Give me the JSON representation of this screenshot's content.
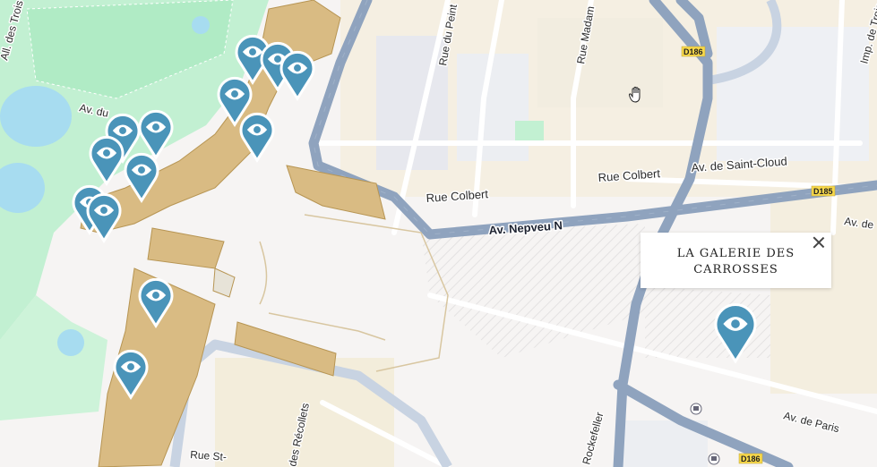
{
  "map": {
    "streets": [
      {
        "id": "rue-colbert-1",
        "text": "Rue Colbert"
      },
      {
        "id": "rue-colbert-2",
        "text": "Rue Colbert"
      },
      {
        "id": "av-saint-cloud",
        "text": "Av. de Saint-Cloud"
      },
      {
        "id": "av-nepveu",
        "text": "Av. Nepveu N"
      },
      {
        "id": "rue-peintres",
        "text": "Rue du Peint"
      },
      {
        "id": "rue-madame",
        "text": "Rue Madam"
      },
      {
        "id": "imp-trois",
        "text": "Imp. de Trois"
      },
      {
        "id": "av-du",
        "text": "Av. du"
      },
      {
        "id": "all-trois",
        "text": "All. des Trois"
      },
      {
        "id": "av-de-right",
        "text": "Av. de"
      },
      {
        "id": "av-paris",
        "text": "Av. de Paris"
      },
      {
        "id": "rue-st",
        "text": "Rue St-"
      },
      {
        "id": "rue-recollets",
        "text": "des Récollets"
      },
      {
        "id": "rockefeller",
        "text": "Rockefeller"
      }
    ],
    "shields": [
      {
        "id": "d186-top",
        "text": "D186"
      },
      {
        "id": "d185",
        "text": "D185"
      },
      {
        "id": "d186-bottom",
        "text": "D186"
      }
    ],
    "marker_count": 12,
    "colors": {
      "marker": "#4a94b9",
      "road_major": "#8fa3be",
      "park": "#b7efcb",
      "water": "#a7dcf0",
      "building_palace": "#d9bb83"
    }
  },
  "popup": {
    "title": "La Galerie des Carrosses"
  }
}
